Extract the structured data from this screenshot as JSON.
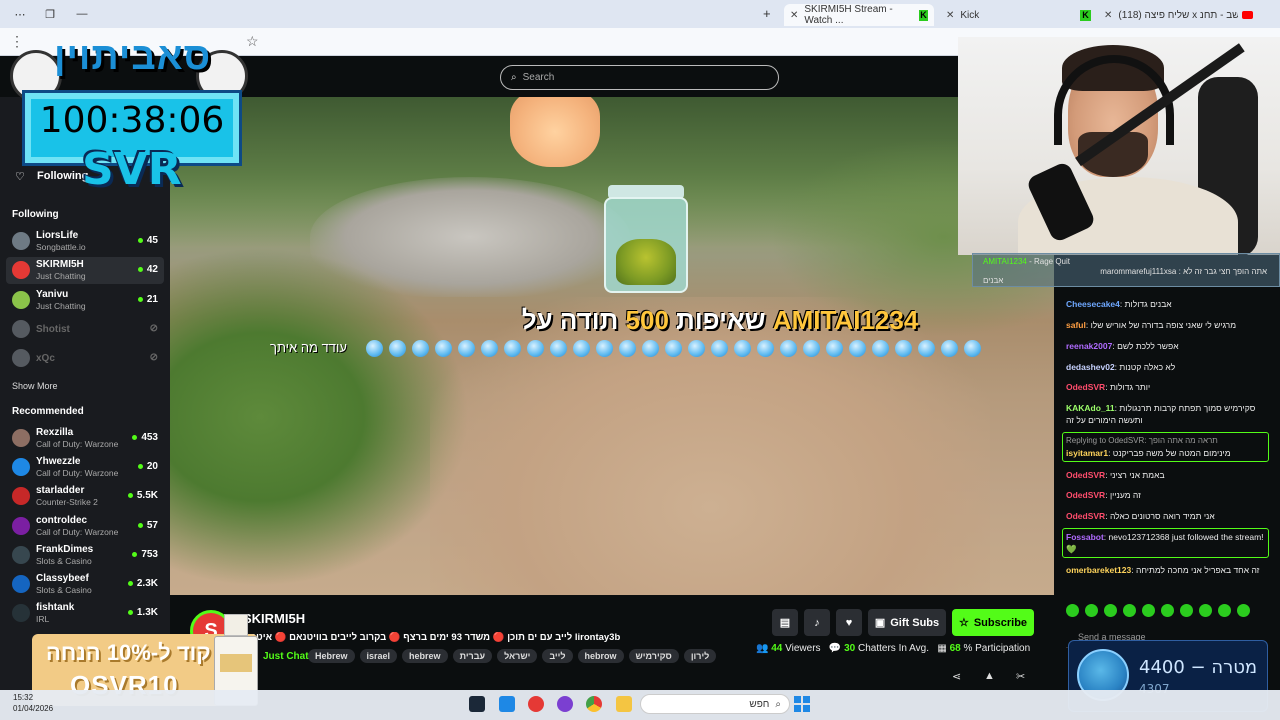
{
  "browser": {
    "tabs": [
      {
        "title": "SKIRMI5H Stream - Watch ..."
      },
      {
        "title": "Kick"
      },
      {
        "title": "(118) שליח פיצה x דשב - תחנ..."
      }
    ],
    "new_tab_glyph": "+",
    "close_glyph": "✕"
  },
  "header": {
    "search_placeholder": "Search"
  },
  "sidebar": {
    "following_top_label": "Following",
    "following_heading": "Following",
    "following": [
      {
        "name": "LiorsLife",
        "sub": "Songbattle.io",
        "viewers": "45",
        "live": true,
        "avatar_color": "#6e7a84"
      },
      {
        "name": "SKIRMI5H",
        "sub": "Just Chatting",
        "viewers": "42",
        "live": true,
        "avatar_color": "#e53935"
      },
      {
        "name": "Yanivu",
        "sub": "Just Chatting",
        "viewers": "21",
        "live": true,
        "avatar_color": "#8bc34a"
      },
      {
        "name": "Shotist",
        "sub": "",
        "viewers": "",
        "live": false,
        "avatar_color": "#555a60"
      },
      {
        "name": "xQc",
        "sub": "",
        "viewers": "",
        "live": false,
        "avatar_color": "#555a60"
      }
    ],
    "show_more_1": "Show More",
    "recommended_heading": "Recommended",
    "recommended": [
      {
        "name": "Rexzilla",
        "sub": "Call of Duty: Warzone",
        "viewers": "453",
        "avatar_color": "#8d6e63"
      },
      {
        "name": "Yhwezzle",
        "sub": "Call of Duty: Warzone",
        "viewers": "20",
        "avatar_color": "#1e88e5"
      },
      {
        "name": "starladder",
        "sub": "Counter-Strike 2",
        "viewers": "5.5K",
        "avatar_color": "#c62828"
      },
      {
        "name": "controldec",
        "sub": "Call of Duty: Warzone",
        "viewers": "57",
        "avatar_color": "#7b1fa2"
      },
      {
        "name": "FrankDimes",
        "sub": "Slots & Casino",
        "viewers": "753",
        "avatar_color": "#37474f"
      },
      {
        "name": "Classybeef",
        "sub": "Slots & Casino",
        "viewers": "2.3K",
        "avatar_color": "#1565c0"
      },
      {
        "name": "fishtank",
        "sub": "IRL",
        "viewers": "1.3K",
        "avatar_color": "#263238"
      }
    ]
  },
  "overlay": {
    "logo_text": "סאביתוין",
    "timer": "100:38:06",
    "tag": "SVR"
  },
  "alert": {
    "message_prefix": "תודה על",
    "amount": "500",
    "message_suffix": "שאיפות",
    "user": "AMITAI1234",
    "sub_text": "עודד מה איתך"
  },
  "stream": {
    "streamer": "SKIRMI5H",
    "title": "לייב עם ים תוכן 🔴 משדר 93 ימים ברצף 🔴 בקרוב לייבים בוויטנאם 🔴 איטסס lirontay3b",
    "category": "Just Chatting",
    "tags": [
      "Hebrew",
      "israel",
      "hebrew",
      "עברית",
      "ישראל",
      "לייב",
      "hebrow",
      "סקירמיש",
      "לירון"
    ],
    "viewers": "44",
    "viewers_label": "Viewers",
    "chatters": "30",
    "chatters_label": "Chatters In Avg.",
    "participation": "68",
    "participation_label": "% Participation",
    "gift_label": "Gift Subs",
    "subscribe_label": "Subscribe"
  },
  "chat": {
    "pinned": {
      "user": "AMITAI1234",
      "tag": "Rage Quit",
      "text": "אתה הופך חצי גבר זה לא",
      "author": "marommarefuj111xsa",
      "text2": "אבנים"
    },
    "messages": [
      {
        "user": "Cheesecake4",
        "color": "#6fa8ff",
        "text": "אבנים גדולות"
      },
      {
        "user": "saful",
        "color": "#ff9f43",
        "text": "מרגיש לי שאני צופה בדורה של אוריש שלו"
      },
      {
        "user": "reenak2007",
        "color": "#b06bff",
        "text": "אפשר ללכת לשם"
      },
      {
        "user": "dedashev02",
        "color": "#c7d2ff",
        "text": "לא כאלה קטנות"
      },
      {
        "user": "OdedSVR",
        "color": "#ff4d6d",
        "text": "יותר גדולות"
      },
      {
        "user": "KAKAdo_11",
        "color": "#9dff6b",
        "text": "סקירמיש סמוך תפתח קרבות תרנגולות ותעשה הימורים על זה"
      },
      {
        "user": "isyitamar1",
        "color": "#ffd45c",
        "text": "מינימום המטה של משה פבריקנט",
        "reply_to": "Replying to OdedSVR: תראה מה אתה הופך"
      },
      {
        "user": "OdedSVR",
        "color": "#ff4d6d",
        "text": "באמת אני רציני"
      },
      {
        "user": "OdedSVR",
        "color": "#ff4d6d",
        "text": "זה מעניין"
      },
      {
        "user": "OdedSVR",
        "color": "#ff4d6d",
        "text": "אני תמיד רואה סרטונים כאלה"
      },
      {
        "user": "Fossabot",
        "color": "#b06bff",
        "text": "nevo123712368 just followed the stream! 💚"
      },
      {
        "user": "omerbareket123",
        "color": "#ffd45c",
        "text": "זה אחד באפריל אני מחכה למתיחה"
      }
    ],
    "send_placeholder": "Send a message"
  },
  "goal": {
    "current": "4400",
    "label": "מטרה",
    "sub": "4307"
  },
  "ad": {
    "line1": "קוד ל-10% הנחה",
    "line2": "OSVR10"
  },
  "taskbar": {
    "time": "15:32",
    "date": "01/04/2026",
    "search_label": "חפש"
  },
  "colors": {
    "kick_green": "#53fc18",
    "sidebar_bg": "#191b1f",
    "page_bg": "#0b0e0f"
  }
}
